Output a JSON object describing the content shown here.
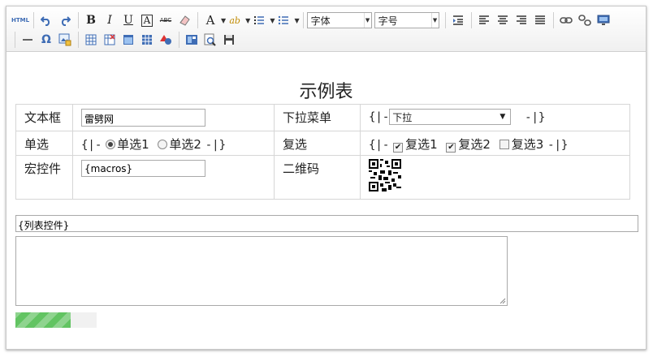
{
  "toolbar": {
    "html_label": "HTML",
    "bold_label": "B",
    "italic_label": "I",
    "underline_label": "U",
    "border_letter": "A",
    "strike_label": "ABC",
    "font_color_label": "A",
    "highlight_label": "ab",
    "font_family": "字体",
    "font_size": "字号",
    "omega_label": "Ω",
    "row1_icons": [
      "html-icon",
      "undo-icon",
      "redo-icon",
      "bold-icon",
      "italic-icon",
      "underline-icon",
      "font-border-icon",
      "strikethrough-icon",
      "eraser-icon",
      "font-color-icon",
      "highlight-icon",
      "ordered-list-icon",
      "unordered-list-icon",
      "font-family-select",
      "font-size-select",
      "indent-icon",
      "align-left-icon",
      "align-center-icon",
      "align-right-icon",
      "align-justify-icon",
      "link-icon",
      "unlink-icon",
      "fullscreen-icon"
    ],
    "row2_icons": [
      "horizontal-rule-icon",
      "special-char-icon",
      "image-icon",
      "table-icon",
      "delete-table-icon",
      "merge-cells-icon",
      "split-cells-icon",
      "chart-icon",
      "template-icon",
      "preview-icon",
      "save-icon"
    ]
  },
  "document": {
    "title": "示例表",
    "rows": [
      {
        "label1": "文本框",
        "textbox_value": "雷劈网",
        "label2": "下拉菜单",
        "select_prefix": "{|-",
        "select_value": "下拉",
        "select_suffix": "-|}"
      },
      {
        "label1": "单选",
        "radio_prefix": "{|-",
        "radio1": "单选1",
        "radio2": "单选2",
        "radio_suffix": "-|}",
        "label2": "复选",
        "check_prefix": "{|-",
        "check1": "复选1",
        "check2": "复选2",
        "check3": "复选3",
        "check_suffix": "-|}"
      },
      {
        "label1": "宏控件",
        "macro_value": "{macros}",
        "label2": "二维码"
      }
    ],
    "list_control": "{列表控件}",
    "progress_fraction": 0.68
  },
  "colors": {
    "progress": "#62c462",
    "border": "#a9a9a9",
    "toolbar_icon": "#3f6db5"
  }
}
